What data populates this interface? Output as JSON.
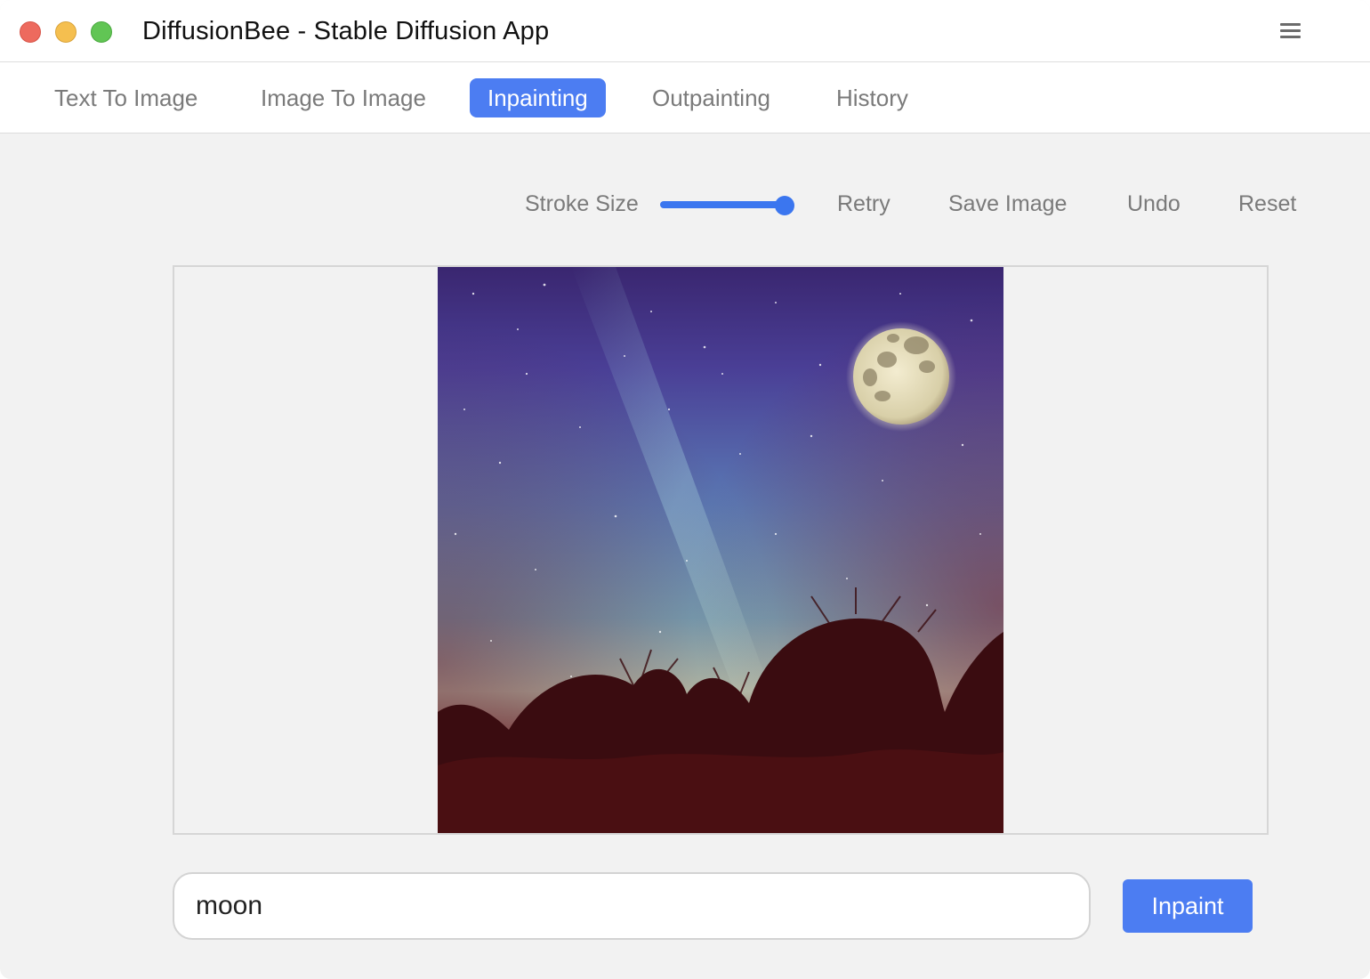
{
  "window": {
    "title": "DiffusionBee - Stable Diffusion App"
  },
  "icons": {
    "menu": "hamburger-menu-icon"
  },
  "tabs": [
    {
      "label": "Text To Image",
      "active": false
    },
    {
      "label": "Image To Image",
      "active": false
    },
    {
      "label": "Inpainting",
      "active": true
    },
    {
      "label": "Outpainting",
      "active": false
    },
    {
      "label": "History",
      "active": false
    }
  ],
  "toolbar": {
    "stroke_size_label": "Stroke Size",
    "stroke_size_level": 0.95,
    "retry_label": "Retry",
    "save_image_label": "Save Image",
    "undo_label": "Undo",
    "reset_label": "Reset"
  },
  "prompt": {
    "value": "moon"
  },
  "inpaint_button": {
    "label": "Inpaint"
  },
  "colors": {
    "accent": "#4c7df2",
    "slider": "#3b76ef",
    "tab_inactive_text": "#7a7a7a",
    "panel_background": "#f2f2f2"
  }
}
